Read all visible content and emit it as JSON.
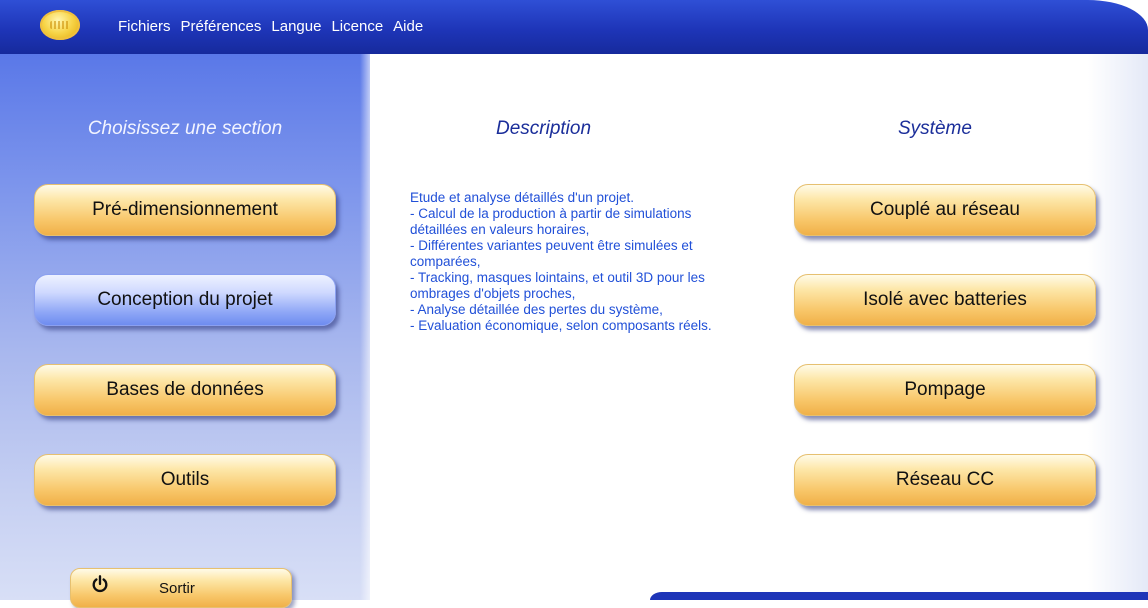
{
  "menu": {
    "items": [
      "Fichiers",
      "Préférences",
      "Langue",
      "Licence",
      "Aide"
    ]
  },
  "left": {
    "title": "Choisissez une section",
    "buttons": [
      {
        "label": "Pré-dimensionnement"
      },
      {
        "label": "Conception du projet"
      },
      {
        "label": "Bases de données"
      },
      {
        "label": "Outils"
      }
    ],
    "exit_label": "Sortir"
  },
  "description": {
    "heading": "Description",
    "text": "Etude et analyse détaillés d'un projet.\n- Calcul de la production à partir de simulations détaillées en valeurs horaires,\n- Différentes variantes peuvent être simulées et comparées,\n- Tracking, masques lointains, et outil 3D pour les ombrages d'objets proches,\n- Analyse détaillée des pertes du système,\n- Evaluation économique, selon composants réels."
  },
  "system": {
    "heading": "Système",
    "buttons": [
      {
        "label": "Couplé au réseau"
      },
      {
        "label": "Isolé avec batteries"
      },
      {
        "label": "Pompage"
      },
      {
        "label": "Réseau CC"
      }
    ]
  },
  "colors": {
    "menubar": "#1e35b8",
    "button_orange": "#f8c76a",
    "button_blue": "#8ea6f6",
    "description_text": "#2150d8",
    "heading": "#1b2e9a"
  }
}
